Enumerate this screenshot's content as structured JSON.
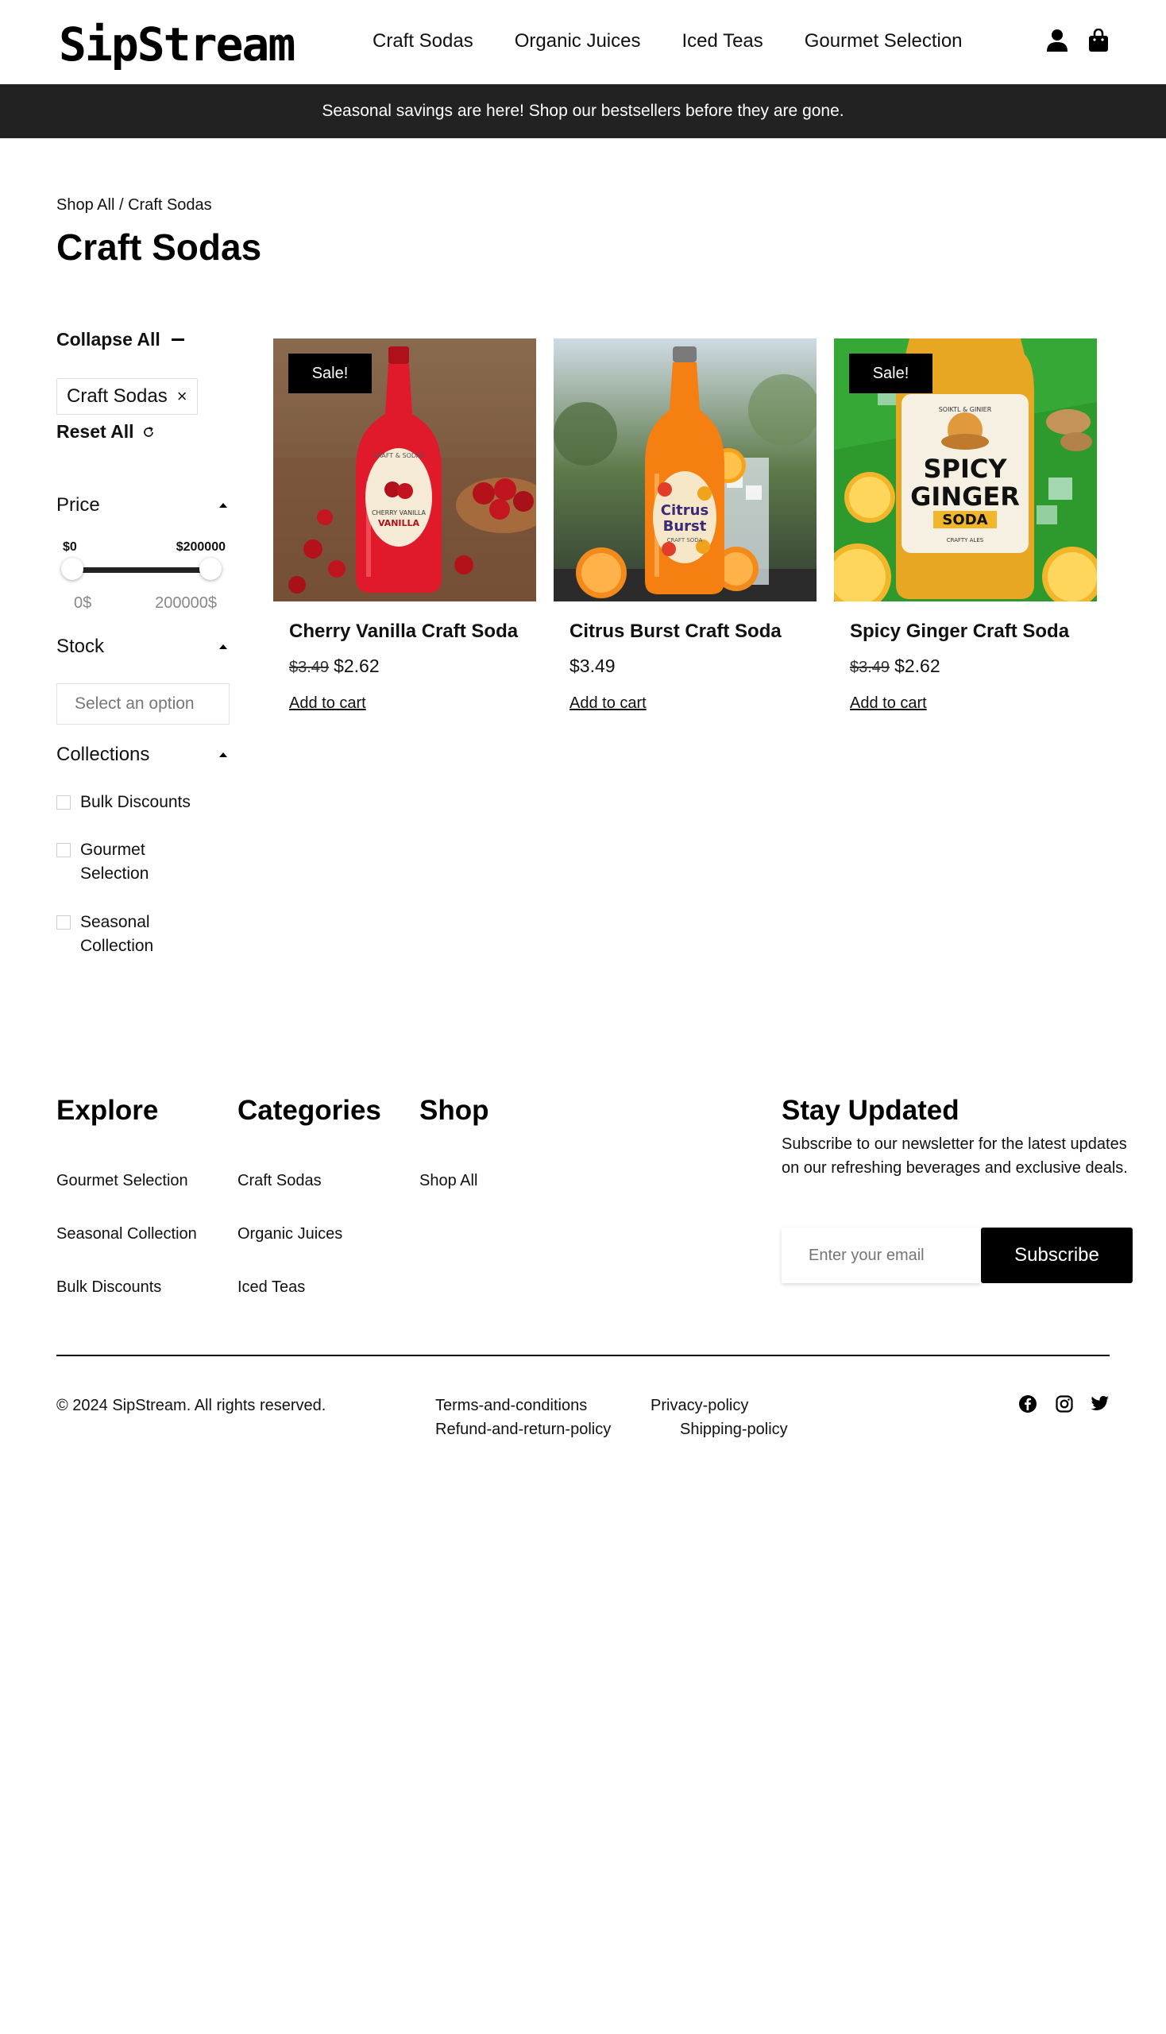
{
  "header": {
    "logo": "SipStream",
    "nav": [
      "Craft Sodas",
      "Organic Juices",
      "Iced Teas",
      "Gourmet Selection"
    ],
    "icons": [
      "user-icon",
      "shopping-bag-icon"
    ]
  },
  "promo": {
    "text": "Seasonal savings are here! Shop our bestsellers before they are gone."
  },
  "breadcrumb": {
    "parent": "Shop All",
    "separator": " / ",
    "current": "Craft Sodas"
  },
  "page_title": "Craft Sodas",
  "filters": {
    "collapse_all": "Collapse All",
    "active_chip": "Craft Sodas",
    "chip_close": "×",
    "reset_all": "Reset All",
    "price": {
      "label": "Price",
      "min_label": "$0",
      "max_label": "$200000",
      "min_value": "0$",
      "max_value": "200000$"
    },
    "stock": {
      "label": "Stock",
      "placeholder": "Select an option"
    },
    "collections": {
      "label": "Collections",
      "items": [
        [
          "Bulk Discounts"
        ],
        [
          "Gourmet",
          "Selection"
        ],
        [
          "Seasonal",
          "Collection"
        ]
      ]
    }
  },
  "products": [
    {
      "name": "Cherry Vanilla Craft Soda",
      "old_price": "$3.49",
      "price": "$2.62",
      "sale_badge": "Sale!",
      "add_to_cart": "Add to cart",
      "label_lines": [
        "CRAFT & SODAS",
        "CHERRY VANILLA",
        "VANILLA"
      ]
    },
    {
      "name": "Citrus Burst Craft Soda",
      "old_price": "",
      "price": "$3.49",
      "sale_badge": "",
      "add_to_cart": "Add to cart",
      "label_lines": [
        "Citrus",
        "Burst",
        "CRAFT SODA"
      ]
    },
    {
      "name": "Spicy Ginger Craft Soda",
      "old_price": "$3.49",
      "price": "$2.62",
      "sale_badge": "Sale!",
      "add_to_cart": "Add to cart",
      "label_lines": [
        "SOIKTL & GINIER",
        "SPICY",
        "GINGER",
        "SODA",
        "CRAFTY ALES"
      ]
    }
  ],
  "footer": {
    "explore": {
      "title": "Explore",
      "links": [
        "Gourmet Selection",
        "Seasonal Collection",
        "Bulk Discounts"
      ]
    },
    "categories": {
      "title": "Categories",
      "links": [
        "Craft Sodas",
        "Organic Juices",
        "Iced Teas"
      ]
    },
    "shop": {
      "title": "Shop",
      "links": [
        "Shop All"
      ]
    },
    "newsletter": {
      "title": "Stay Updated",
      "text": "Subscribe to our newsletter for the latest updates on our refreshing beverages and exclusive deals.",
      "placeholder": "Enter your email",
      "button": "Subscribe"
    },
    "copyright": "© 2024 SipStream. All rights reserved.",
    "policies": [
      "Terms-and-conditions",
      "Privacy-policy",
      "Refund-and-return-policy",
      "Shipping-policy"
    ],
    "social": [
      "facebook-icon",
      "instagram-icon",
      "twitter-icon"
    ]
  }
}
